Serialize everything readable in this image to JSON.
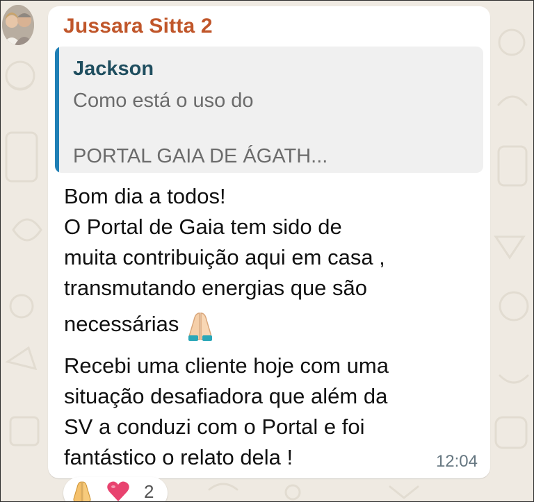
{
  "sender": {
    "name": "Jussara Sitta 2",
    "color": "#c0562a"
  },
  "quote": {
    "author": "Jackson",
    "author_color": "#1f4e5f",
    "bar_color": "#1f7fb5",
    "line1": "Como está o uso do",
    "line2": "PORTAL GAIA DE ÁGATH..."
  },
  "message": {
    "lines": [
      "Bom dia a todos!",
      "O Portal de Gaia tem sido de",
      "muita contribuição aqui em casa ,",
      "transmutando energias que são",
      "necessárias",
      "Recebi uma cliente hoje com uma",
      "situação desafiadora que além da",
      "SV a conduzi com o Portal e foi",
      "fantástico o relato dela !"
    ],
    "inline_emoji": "folded-hands-icon",
    "time": "12:04"
  },
  "reactions": {
    "emojis": [
      "folded-hands-icon",
      "heart-icon"
    ],
    "count": "2"
  }
}
